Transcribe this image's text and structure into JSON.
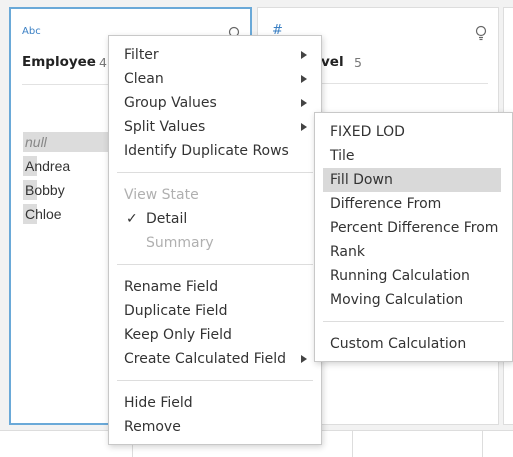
{
  "fields": [
    {
      "type_badge": "Abc",
      "name": "Employee",
      "count": "4",
      "values": [
        {
          "label": "null",
          "is_null": true,
          "bar": 1.0
        },
        {
          "label": "Andrea",
          "is_null": false,
          "bar": 0.2
        },
        {
          "label": "Bobby",
          "is_null": false,
          "bar": 0.2
        },
        {
          "label": "Chloe",
          "is_null": false,
          "bar": 0.2
        }
      ]
    },
    {
      "type_badge": "#",
      "name": "vel",
      "count": "5"
    }
  ],
  "context_menu": {
    "items": [
      {
        "label": "Filter",
        "submenu": true
      },
      {
        "label": "Clean",
        "submenu": true
      },
      {
        "label": "Group Values",
        "submenu": true
      },
      {
        "label": "Split Values",
        "submenu": true
      },
      {
        "label": "Identify Duplicate Rows",
        "submenu": false
      }
    ],
    "view_state": {
      "header": "View State",
      "detail": "Detail",
      "detail_checked": true,
      "summary": "Summary"
    },
    "field_actions": [
      {
        "label": "Rename Field",
        "submenu": false
      },
      {
        "label": "Duplicate Field",
        "submenu": false
      },
      {
        "label": "Keep Only Field",
        "submenu": false
      },
      {
        "label": "Create Calculated Field",
        "submenu": true
      }
    ],
    "visibility": [
      {
        "label": "Hide Field"
      },
      {
        "label": "Remove"
      }
    ]
  },
  "calc_submenu": {
    "items": [
      "FIXED LOD",
      "Tile",
      "Fill Down",
      "Difference From",
      "Percent Difference From",
      "Rank",
      "Running Calculation",
      "Moving Calculation"
    ],
    "highlighted": "Fill Down",
    "custom": "Custom Calculation"
  },
  "colors": {
    "selected_card_border": "#6aa9d8",
    "type_badge": "#3b80c4",
    "menu_hover": "#d9d9d9",
    "value_bar": "#dcdcdc"
  },
  "icons": {
    "field_recommendation": "lightbulb-icon",
    "submenu_arrow": "triangle-right-icon",
    "checkmark": "check-icon"
  }
}
